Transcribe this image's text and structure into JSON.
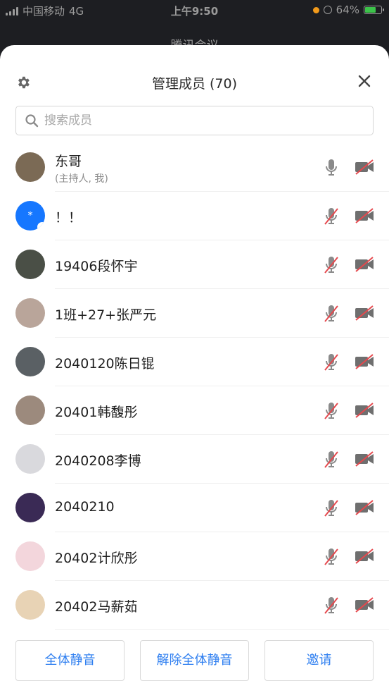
{
  "status_bar": {
    "carrier": "中国移动",
    "network": "4G",
    "time": "上午9:50",
    "battery": "64%"
  },
  "background_title": "腾讯会议",
  "sheet": {
    "title": "管理成员 (70)",
    "search_placeholder": "搜索成员"
  },
  "members": [
    {
      "name": "东哥",
      "sub": "(主持人, 我)",
      "muted": false,
      "video_off": true,
      "avatar_color": "#7b6a55"
    },
    {
      "name": "！！",
      "sub": "",
      "muted": true,
      "video_off": true,
      "avatar_color": "#1677ff"
    },
    {
      "name": "19406段怀宇",
      "sub": "",
      "muted": true,
      "video_off": true,
      "avatar_color": "#4a4f46"
    },
    {
      "name": "1班+27+张严元",
      "sub": "",
      "muted": true,
      "video_off": true,
      "avatar_color": "#b9a59a"
    },
    {
      "name": "2040120陈日锟",
      "sub": "",
      "muted": true,
      "video_off": true,
      "avatar_color": "#5a6064"
    },
    {
      "name": "20401韩馥彤",
      "sub": "",
      "muted": true,
      "video_off": true,
      "avatar_color": "#9c8a7d"
    },
    {
      "name": "2040208李博",
      "sub": "",
      "muted": true,
      "video_off": true,
      "avatar_color": "#d9d9dd"
    },
    {
      "name": "2040210",
      "sub": "",
      "muted": true,
      "video_off": true,
      "avatar_color": "#3a2a55"
    },
    {
      "name": "20402计欣彤",
      "sub": "",
      "muted": true,
      "video_off": true,
      "avatar_color": "#f3d6dc"
    },
    {
      "name": "20402马薪茹",
      "sub": "",
      "muted": true,
      "video_off": true,
      "avatar_color": "#e8d3b5"
    }
  ],
  "footer": {
    "mute_all": "全体静音",
    "unmute_all": "解除全体静音",
    "invite": "邀请"
  },
  "colors": {
    "accent": "#2f7ff0",
    "muted_red": "#e5484d",
    "icon_gray": "#8a8a8a"
  }
}
